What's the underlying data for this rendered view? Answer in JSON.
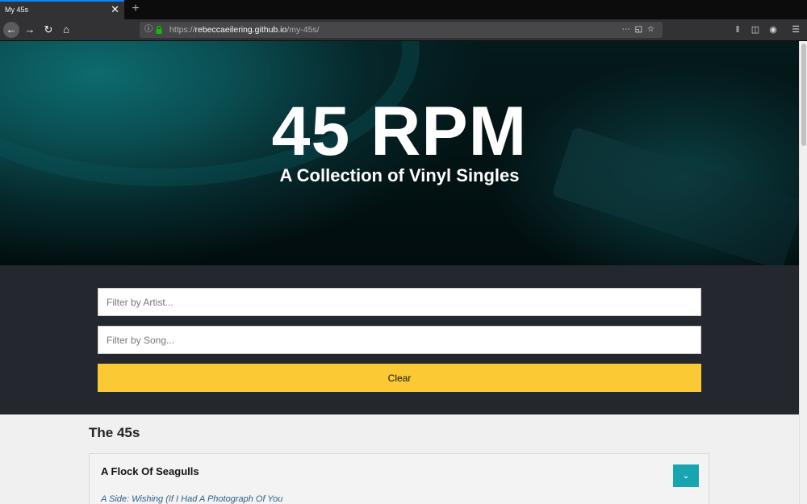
{
  "browser": {
    "tab_title": "My 45s",
    "tab_close": "✕",
    "new_tab": "+",
    "url_scheme": "https://",
    "url_domain": "rebeccaeilering.github.io",
    "url_path": "/my-45s/",
    "icons": [
      "back-arrow-icon",
      "forward-arrow-icon",
      "reload-icon",
      "home-icon",
      "info-icon",
      "lock-icon",
      "more-dots-icon",
      "pocket-icon",
      "star-icon",
      "library-icon",
      "sidebar-icon",
      "extension-icon",
      "menu-icon"
    ]
  },
  "hero": {
    "title": "45 RPM",
    "subtitle": "A Collection of Vinyl Singles"
  },
  "filters": {
    "artist_placeholder": "Filter by Artist...",
    "song_placeholder": "Filter by Song...",
    "clear_label": "Clear",
    "accent_color": "#fbc933",
    "background_color": "#24282e"
  },
  "list": {
    "title": "The 45s",
    "records": [
      {
        "artist": "A Flock Of Seagulls",
        "a_side": "A Side: Wishing (If I Had A Photograph Of You"
      }
    ],
    "expand_color": "#17a5b0"
  }
}
